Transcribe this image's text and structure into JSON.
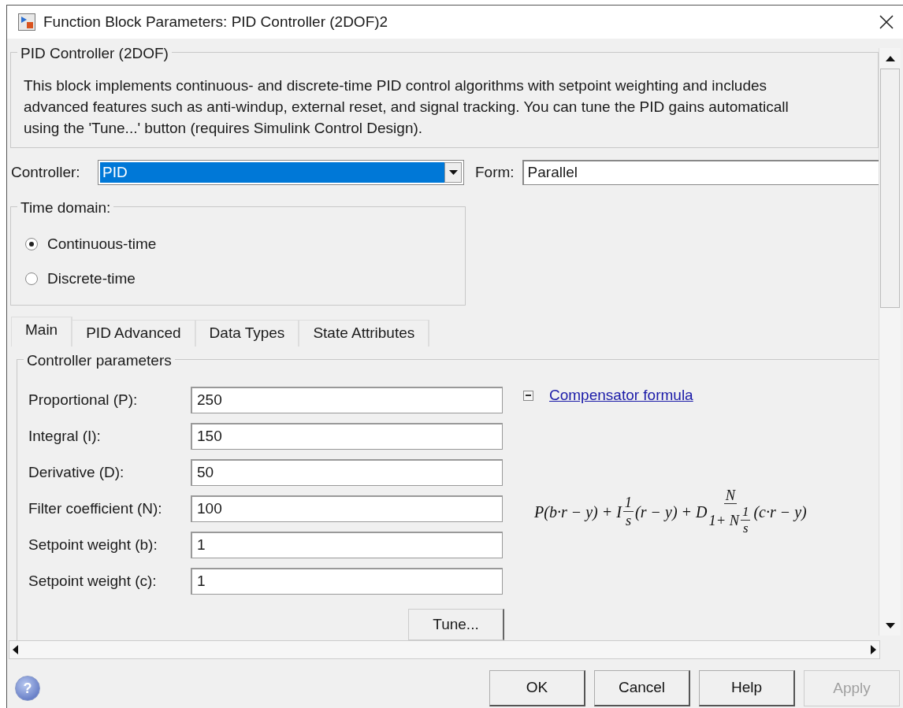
{
  "window": {
    "title": "Function Block Parameters: PID Controller (2DOF)2"
  },
  "block_group": {
    "title": "PID Controller (2DOF)",
    "description": [
      "This block implements continuous- and discrete-time PID control algorithms with setpoint weighting and includes",
      "advanced features such as anti-windup, external reset, and signal tracking. You can tune the PID gains automaticall",
      "using the 'Tune...' button (requires Simulink Control Design)."
    ]
  },
  "controller": {
    "label": "Controller:",
    "value": "PID",
    "form_label": "Form:",
    "form_value": "Parallel"
  },
  "time_domain": {
    "title": "Time domain:",
    "options": [
      {
        "label": "Continuous-time",
        "selected": true
      },
      {
        "label": "Discrete-time",
        "selected": false
      }
    ]
  },
  "tabs": [
    {
      "label": "Main",
      "selected": true
    },
    {
      "label": "PID Advanced",
      "selected": false
    },
    {
      "label": "Data Types",
      "selected": false
    },
    {
      "label": "State Attributes",
      "selected": false
    }
  ],
  "parameters": {
    "title": "Controller parameters",
    "rows": [
      {
        "label": "Proportional (P):",
        "value": "250"
      },
      {
        "label": "Integral (I):",
        "value": "150"
      },
      {
        "label": "Derivative (D):",
        "value": "50"
      },
      {
        "label": "Filter coefficient (N):",
        "value": "100"
      },
      {
        "label": "Setpoint weight (b):",
        "value": "1"
      },
      {
        "label": "Setpoint weight (c):",
        "value": "1"
      }
    ],
    "tune_button": "Tune...",
    "formula_link": {
      "label": "Compensator formula",
      "expanded": true
    },
    "formula": [
      {
        "kind": "text",
        "text": "P(b·r − y) + I"
      },
      {
        "kind": "frac",
        "numerator": [
          {
            "kind": "text",
            "text": "1"
          }
        ],
        "denominator": [
          {
            "kind": "text",
            "text": "s"
          }
        ]
      },
      {
        "kind": "text",
        "text": "(r − y) + D"
      },
      {
        "kind": "frac",
        "numerator": [
          {
            "kind": "text",
            "text": "N"
          }
        ],
        "denominator": [
          {
            "kind": "text",
            "text": "1+ N"
          },
          {
            "kind": "frac",
            "numerator": [
              {
                "kind": "text",
                "text": "1"
              }
            ],
            "denominator": [
              {
                "kind": "text",
                "text": "s"
              }
            ]
          }
        ]
      },
      {
        "kind": "text",
        "text": "(c·r − y)"
      }
    ]
  },
  "help_icon": "?",
  "buttons": [
    {
      "label": "OK",
      "disabled": false
    },
    {
      "label": "Cancel",
      "disabled": false
    },
    {
      "label": "Help",
      "disabled": false
    },
    {
      "label": "Apply",
      "disabled": true
    }
  ]
}
